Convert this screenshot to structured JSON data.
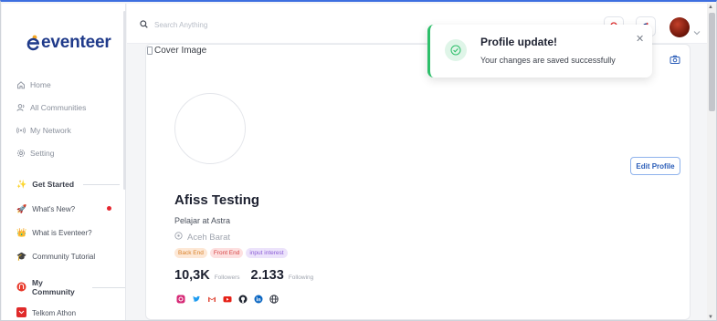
{
  "app": {
    "brand": "eventeer",
    "brand_color": "#1f3a8a",
    "accent_color": "#f5a623"
  },
  "sidebar": {
    "nav": [
      {
        "label": "Home",
        "icon": "home-icon"
      },
      {
        "label": "All Communities",
        "icon": "users-icon"
      },
      {
        "label": "My Network",
        "icon": "network-icon"
      },
      {
        "label": "Setting",
        "icon": "gear-icon"
      }
    ],
    "get_started": {
      "title": "Get Started",
      "icon": "sparkle-icon",
      "items": [
        {
          "label": "What's New?",
          "icon": "rocket-icon",
          "has_notification": true
        },
        {
          "label": "What is Eventeer?",
          "icon": "crown-icon"
        },
        {
          "label": "Community Tutorial",
          "icon": "graduation-cap-icon"
        }
      ]
    },
    "my_community": {
      "title": "My Community",
      "icon": "community-logo-icon",
      "items": [
        {
          "label": "Telkom Athon",
          "icon": "telkom-logo-icon"
        }
      ]
    }
  },
  "topbar": {
    "search_placeholder": "Search Anything"
  },
  "profile": {
    "cover_alt": "Cover Image",
    "name": "Afiss Testing",
    "job": "Pelajar at Astra",
    "location": "Aceh Barat",
    "tags": [
      {
        "label": "Back End",
        "bg": "#fde8d6",
        "fg": "#d9822b"
      },
      {
        "label": "Front End",
        "bg": "#fde0e0",
        "fg": "#d64545"
      },
      {
        "label": "input interest",
        "bg": "#ece3fb",
        "fg": "#8a5cd6"
      }
    ],
    "followers_count": "10,3K",
    "followers_label": "Followers",
    "following_count": "2.133",
    "following_label": "Following",
    "edit_button": "Edit Profile",
    "socials": [
      "instagram-icon",
      "twitter-icon",
      "gmail-icon",
      "youtube-icon",
      "github-icon",
      "linkedin-icon",
      "globe-icon"
    ]
  },
  "toast": {
    "title": "Profile update!",
    "message": "Your changes are saved successfully",
    "status_color": "#2dbf6a"
  }
}
